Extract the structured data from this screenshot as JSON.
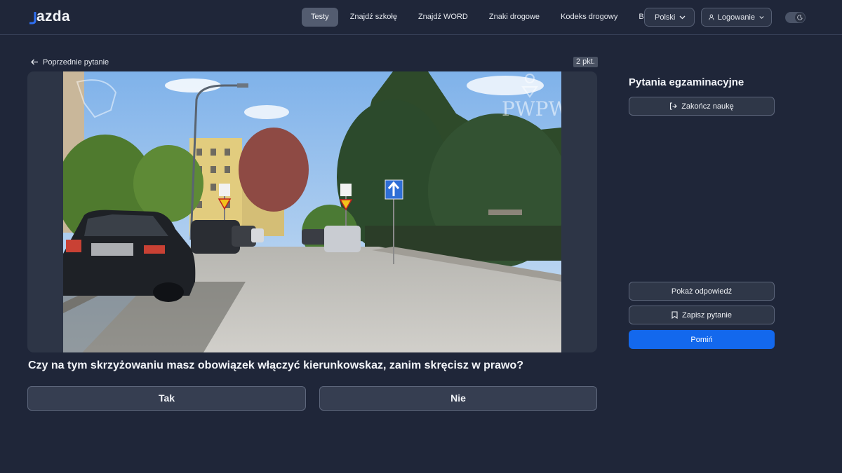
{
  "header": {
    "logo": "Jazda",
    "logo_text": "azda",
    "nav": [
      {
        "label": "Testy",
        "active": true
      },
      {
        "label": "Znajdź szkołę",
        "active": false
      },
      {
        "label": "Znajdź WORD",
        "active": false
      },
      {
        "label": "Znaki drogowe",
        "active": false
      },
      {
        "label": "Kodeks drogowy",
        "active": false
      },
      {
        "label": "Blog",
        "active": false
      }
    ],
    "language": "Polski",
    "login": "Logowanie",
    "theme_icon": "moon-icon"
  },
  "main": {
    "prev_label": "Poprzednie pytanie",
    "points": "2 pkt.",
    "question": "Czy na tym skrzyżowaniu masz obowiązek włączyć kierunkowskaz, zanim skręcisz w prawo?",
    "answers": {
      "yes": "Tak",
      "no": "Nie"
    },
    "watermark": "PWPW"
  },
  "sidebar": {
    "title": "Pytania egzaminacyjne",
    "finish": "Zakończ naukę",
    "show_answer": "Pokaż odpowiedź",
    "save_question": "Zapisz pytanie",
    "skip": "Pomiń"
  },
  "colors": {
    "background": "#1f2639",
    "accent": "#1368ed",
    "active_nav": "#535c70"
  }
}
